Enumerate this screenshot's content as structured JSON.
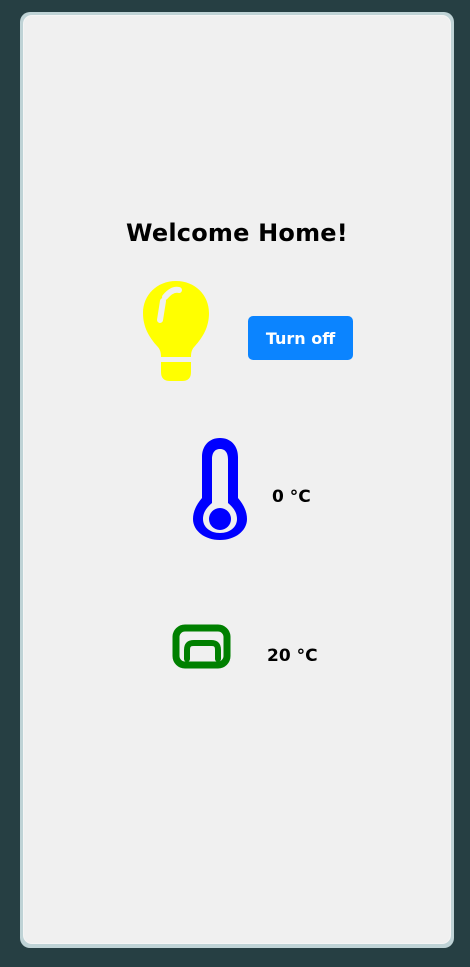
{
  "app": {
    "title": "Welcome Home!"
  },
  "light": {
    "icon": "lightbulb-icon",
    "color": "#ffff00",
    "button_label": "Turn off",
    "button_color": "#0b84ff"
  },
  "temperature": {
    "icon": "thermometer-icon",
    "color": "#0000ff",
    "value": "0 °C"
  },
  "heating": {
    "icon": "heater-icon",
    "color": "#008000",
    "value": "20 °C"
  },
  "colors": {
    "background": "#263f43",
    "panel": "#f0f0f0"
  }
}
